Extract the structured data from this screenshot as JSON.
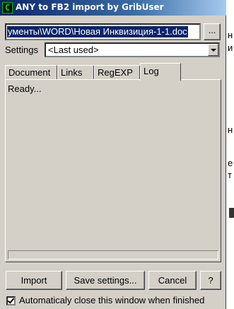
{
  "window": {
    "title": "ANY to FB2 import by GribUser",
    "icon_letter": "C",
    "icon": "app-icon"
  },
  "file": {
    "path": "ументы\\WORD\\Новая Инквизиция-1-1.doc",
    "browse_label": "..."
  },
  "settings": {
    "label": "Settings",
    "selected": "<Last used>"
  },
  "tabs": [
    {
      "label": "Document",
      "active": false
    },
    {
      "label": "Links",
      "active": false
    },
    {
      "label": "RegEXP",
      "active": false
    },
    {
      "label": "Log",
      "active": true
    }
  ],
  "log": {
    "text": "Ready...",
    "progress": 0
  },
  "buttons": {
    "import": "Import",
    "save_settings": "Save settings...",
    "cancel": "Cancel",
    "help": "?"
  },
  "auto_close": {
    "label": "Automaticaly close this window when finished",
    "checked": true
  },
  "background_window": {
    "chars": [
      "н",
      "и",
      "н",
      "е",
      "т"
    ]
  },
  "colors": {
    "face": "#d4d0c8",
    "title_start": "#0a246a",
    "title_end": "#a6caf0",
    "selection": "#0a246a"
  }
}
